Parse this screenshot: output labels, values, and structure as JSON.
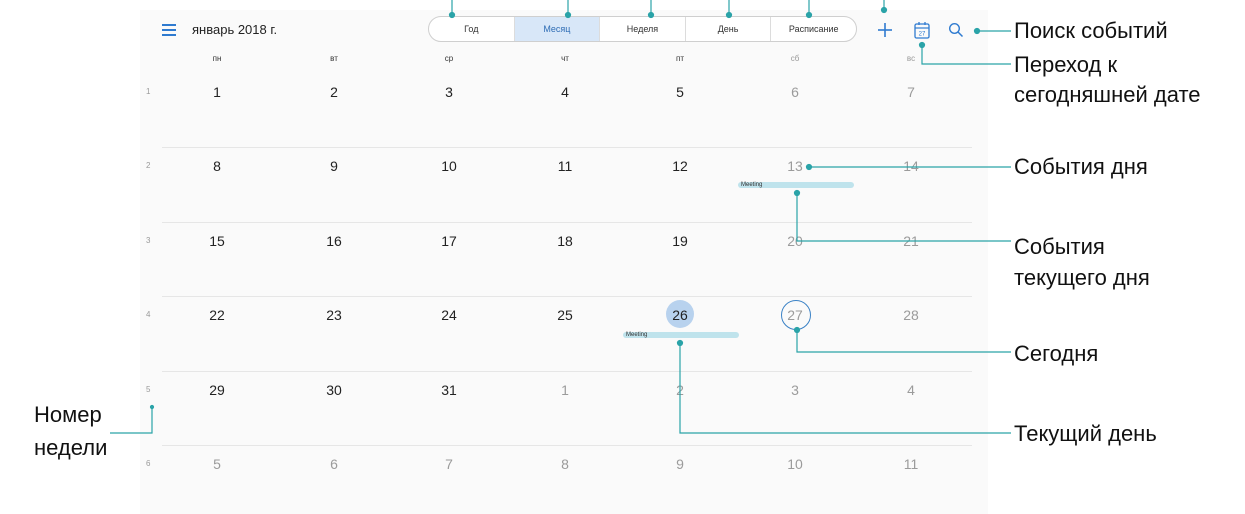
{
  "header": {
    "month_title": "январь 2018 г.",
    "menu_icon": "hamburger-menu-icon",
    "view_tabs": [
      {
        "label": "Год"
      },
      {
        "label": "Месяц",
        "active": true
      },
      {
        "label": "Неделя"
      },
      {
        "label": "День"
      },
      {
        "label": "Расписание"
      }
    ],
    "actions": [
      {
        "icon": "plus-icon"
      },
      {
        "icon": "today-calendar-icon",
        "badge": "27"
      },
      {
        "icon": "search-icon"
      }
    ]
  },
  "calendar": {
    "weekdays": [
      "пн",
      "вт",
      "ср",
      "чт",
      "пт",
      "сб",
      "вс"
    ],
    "weeks": [
      {
        "number": "1",
        "days": [
          "1",
          "2",
          "3",
          "4",
          "5",
          "6",
          "7"
        ]
      },
      {
        "number": "2",
        "days": [
          "8",
          "9",
          "10",
          "11",
          "12",
          "13",
          "14"
        ]
      },
      {
        "number": "3",
        "days": [
          "15",
          "16",
          "17",
          "18",
          "19",
          "20",
          "21"
        ]
      },
      {
        "number": "4",
        "days": [
          "22",
          "23",
          "24",
          "25",
          "26",
          "27",
          "28"
        ]
      },
      {
        "number": "5",
        "days": [
          "29",
          "30",
          "31",
          "1",
          "2",
          "3",
          "4"
        ]
      },
      {
        "number": "6",
        "days": [
          "5",
          "6",
          "7",
          "8",
          "9",
          "10",
          "11"
        ]
      }
    ],
    "events": [
      {
        "label": "Meeting",
        "week": 2,
        "day": 6
      },
      {
        "label": "Meeting",
        "week": 4,
        "day": 5
      }
    ],
    "current_day": "26",
    "today": "27"
  },
  "annotations": {
    "search": "Поиск событий",
    "today_line1": "Переход к",
    "today_line2": "сегодняшней дате",
    "day_events": "События дня",
    "current_day_events_line1": "События",
    "current_day_events_line2": "текущего дня",
    "today_label": "Сегодня",
    "current_day": "Текущий день",
    "week_number_line1": "Номер",
    "week_number_line2": "недели"
  },
  "colors": {
    "accent": "#2f7bd0",
    "active_tab_bg": "#d8e7f8",
    "event_bar": "#bfe3ec",
    "current_day_fill": "#b8d2ee",
    "annotation_line": "#2aa3a8"
  }
}
